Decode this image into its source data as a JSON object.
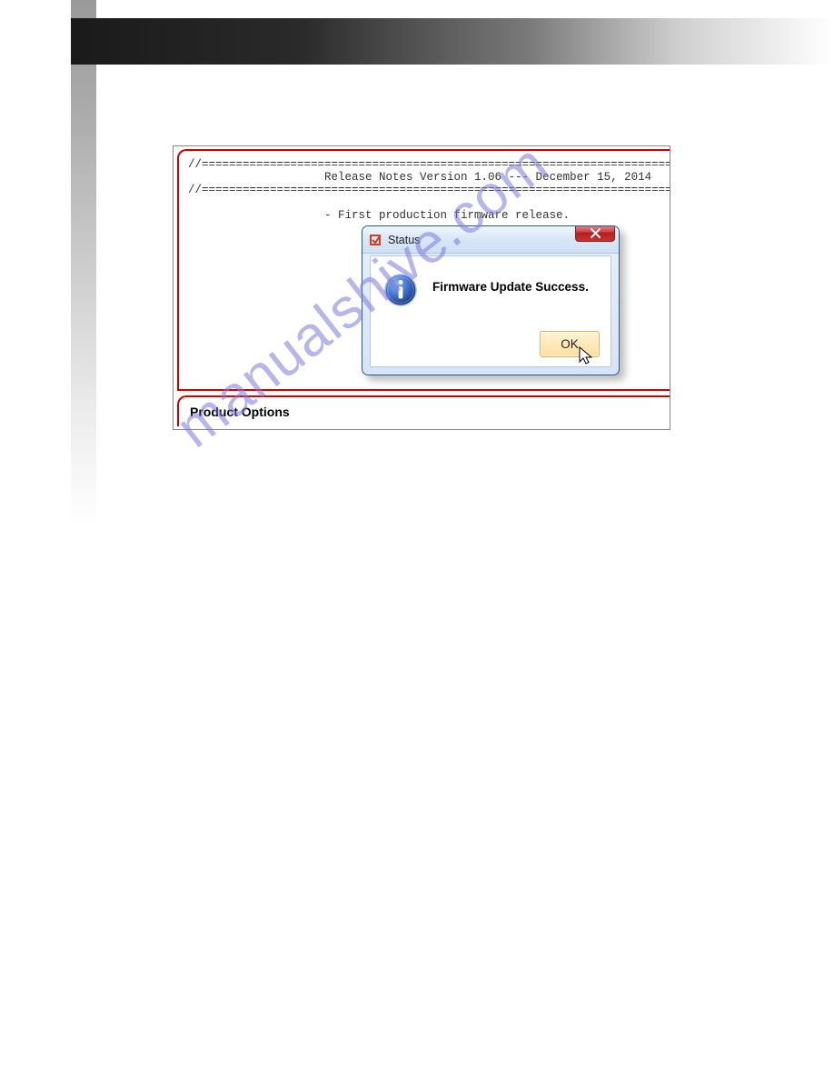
{
  "release_notes": {
    "divider_top": "//===================================================================================",
    "header": "                    Release Notes Version 1.06 --- December 15, 2014",
    "divider_bottom": "//===================================================================================",
    "body_line1": "                    - First production firmware release."
  },
  "product_options": {
    "label": "Product Options"
  },
  "dialog": {
    "title": "Status",
    "message": "Firmware Update Success.",
    "ok_label": "OK",
    "icon_name": "info-icon",
    "close_name": "close-icon"
  },
  "watermark": "manualshive.com"
}
